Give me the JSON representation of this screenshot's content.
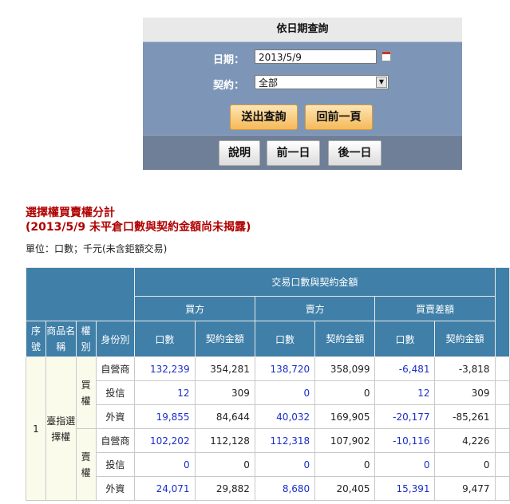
{
  "query": {
    "title": "依日期查詢",
    "date_label": "日期：",
    "date_value": "2013/5/9",
    "contract_label": "契約：",
    "contract_value": "全部",
    "submit_label": "送出查詢",
    "back_label": "回前一頁",
    "help_label": "說明",
    "prev_day_label": "前一日",
    "next_day_label": "後一日"
  },
  "report": {
    "title": "選擇權買賣權分計",
    "subtitle": "(2013/5/9 未平倉口數與契約金額尚未揭露)",
    "unit": "單位：口數；千元(未含鉅額交易)"
  },
  "table": {
    "group_header": "交易口數與契約金額",
    "buy_header": "買方",
    "sell_header": "賣方",
    "diff_header": "買賣差額",
    "col_seq": "序號",
    "col_product": "商品名稱",
    "col_right": "權別",
    "col_identity": "身份別",
    "col_lots": "口數",
    "col_amount": "契約金額",
    "seq": "1",
    "product": "臺指選擇權",
    "call": "買權",
    "put": "賣權",
    "rows": [
      {
        "identity": "自營商",
        "buy_lots": "132,239",
        "buy_amt": "354,281",
        "sell_lots": "138,720",
        "sell_amt": "358,099",
        "diff_lots": "-6,481",
        "diff_amt": "-3,818"
      },
      {
        "identity": "投信",
        "buy_lots": "12",
        "buy_amt": "309",
        "sell_lots": "0",
        "sell_amt": "0",
        "diff_lots": "12",
        "diff_amt": "309"
      },
      {
        "identity": "外資",
        "buy_lots": "19,855",
        "buy_amt": "84,644",
        "sell_lots": "40,032",
        "sell_amt": "169,905",
        "diff_lots": "-20,177",
        "diff_amt": "-85,261"
      },
      {
        "identity": "自營商",
        "buy_lots": "102,202",
        "buy_amt": "112,128",
        "sell_lots": "112,318",
        "sell_amt": "107,902",
        "diff_lots": "-10,116",
        "diff_amt": "4,226"
      },
      {
        "identity": "投信",
        "buy_lots": "0",
        "buy_amt": "0",
        "sell_lots": "0",
        "sell_amt": "0",
        "diff_lots": "0",
        "diff_amt": "0"
      },
      {
        "identity": "外資",
        "buy_lots": "24,071",
        "buy_amt": "29,882",
        "sell_lots": "8,680",
        "sell_amt": "20,405",
        "diff_lots": "15,391",
        "diff_amt": "9,477"
      }
    ]
  }
}
